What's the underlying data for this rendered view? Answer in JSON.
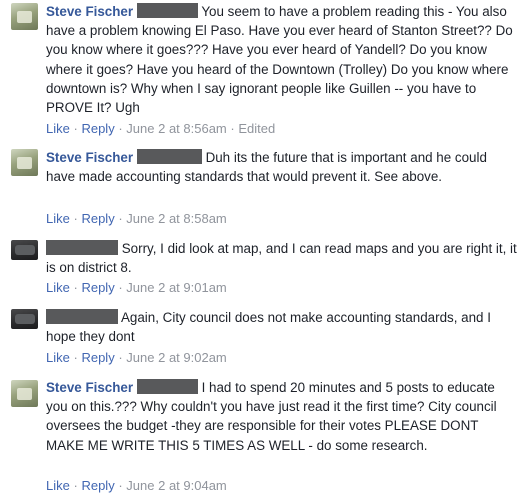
{
  "comments": [
    {
      "author": "Steve Fischer",
      "text": "You seem to have a problem reading this - You also have a problem knowing El Paso. Have you ever heard of Stanton Street?? Do you know where it goes??? Have you ever heard of Yandell? Do you know where it goes? Have you heard of the Downtown (Trolley) Do you know where downtown is? Why when I say ignorant people like Guillen -- you have to PROVE It? Ugh",
      "like": "Like",
      "reply": "Reply",
      "time": "June 2 at 8:56am",
      "edited": "Edited"
    },
    {
      "author": "Steve Fischer",
      "text": "Duh its the future that is important and he could have made accounting standards that would prevent it. See above.",
      "like": "Like",
      "reply": "Reply",
      "time": "June 2 at 8:58am"
    },
    {
      "author": "",
      "text": "Sorry, I did look at map, and I can read maps and you are right it, it is on district 8.",
      "like": "Like",
      "reply": "Reply",
      "time": "June 2 at 9:01am"
    },
    {
      "author": "",
      "text": "Again, City council does not make accounting standards, and I hope they dont",
      "like": "Like",
      "reply": "Reply",
      "time": "June 2 at 9:02am"
    },
    {
      "author": "Steve Fischer",
      "text": "I had to spend 20 minutes and 5 posts to educate you on this.??? Why couldn't you have just read it the first time? City council oversees the budget -they are responsible for their votes PLEASE DONT MAKE ME WRITE THIS 5 TIMES AS WELL - do some research.",
      "like": "Like",
      "reply": "Reply",
      "time": "June 2 at 9:04am"
    }
  ],
  "separator": "·",
  "colors": {
    "link": "#365899",
    "action": "#4267b2",
    "meta": "#90949c",
    "redaction": "#58595b"
  }
}
